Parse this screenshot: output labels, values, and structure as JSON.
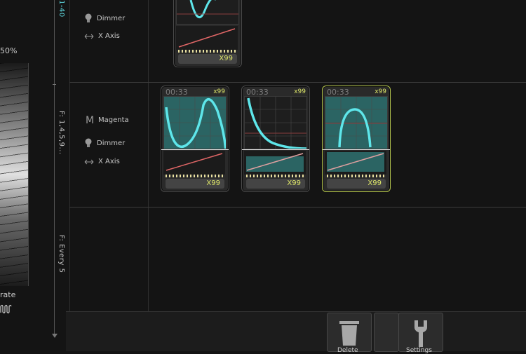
{
  "left_panel": {
    "percent": "50%",
    "rate_label": "rate"
  },
  "ruler": {
    "labels": [
      "1-40",
      "F: 1,4,5,9...",
      "F: Every 5"
    ]
  },
  "rows": [
    {
      "feature": null,
      "dimmer": "Dimmer",
      "axis": "X Axis"
    },
    {
      "feature": "Magenta",
      "dimmer": "Dimmer",
      "axis": "X Axis"
    }
  ],
  "cards": [
    {
      "time": "",
      "mult": "",
      "footer": "X99"
    },
    {
      "time": "00:33",
      "mult": "x99",
      "footer": "X99"
    },
    {
      "time": "00:33",
      "mult": "x99",
      "footer": "X99"
    },
    {
      "time": "00:33",
      "mult": "x99",
      "footer": "X99"
    }
  ],
  "toolbar": {
    "delete_label": "Delete",
    "settings_label": "Settings"
  },
  "colors": {
    "accent_cyan": "#5ee6ea",
    "accent_yellow": "#dfe86a",
    "line_red": "#e06666"
  },
  "icons": [
    "lightbulb-icon",
    "axis-arrow-icon",
    "magenta-m-icon",
    "trash-icon",
    "wrench-icon",
    "wave-icon"
  ]
}
